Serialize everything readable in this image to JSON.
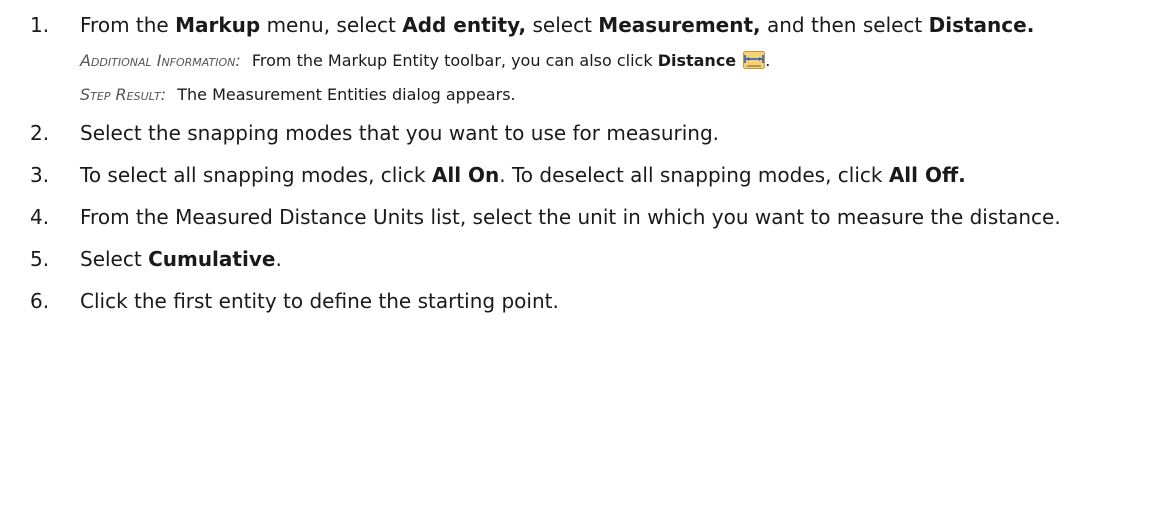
{
  "steps": [
    {
      "num": "1.",
      "t1": "From the ",
      "b1": "Markup",
      "t2": " menu, select ",
      "b2": "Add entity,",
      "t3": " select ",
      "b3": "Measurement,",
      "t4": " and then select ",
      "b4": "Distance.",
      "info_label": "Additional Information:",
      "info_text": "From the Markup Entity toolbar, you can also click ",
      "info_bold": "Distance",
      "info_icon": "distance-measure-icon",
      "info_end": ".",
      "result_label": "Step Result:",
      "result_text": "The Measurement Entities dialog appears."
    },
    {
      "num": "2.",
      "text": "Select the snapping modes that you want to use for measuring."
    },
    {
      "num": "3.",
      "t1": "To select all snapping modes, click ",
      "b1": "All On",
      "t2": ". To deselect all snapping modes, click ",
      "b2": "All Off."
    },
    {
      "num": "4.",
      "text": "From the Measured Distance Units list, select the unit in which you want to measure the distance."
    },
    {
      "num": "5.",
      "t1": "Select ",
      "b1": "Cumulative",
      "t2": "."
    },
    {
      "num": "6.",
      "text": "Click the first entity to define the starting point."
    }
  ],
  "colors": {
    "icon_bg": "#f4d27a",
    "icon_line": "#2a5db0",
    "label_gray": "#555555"
  }
}
